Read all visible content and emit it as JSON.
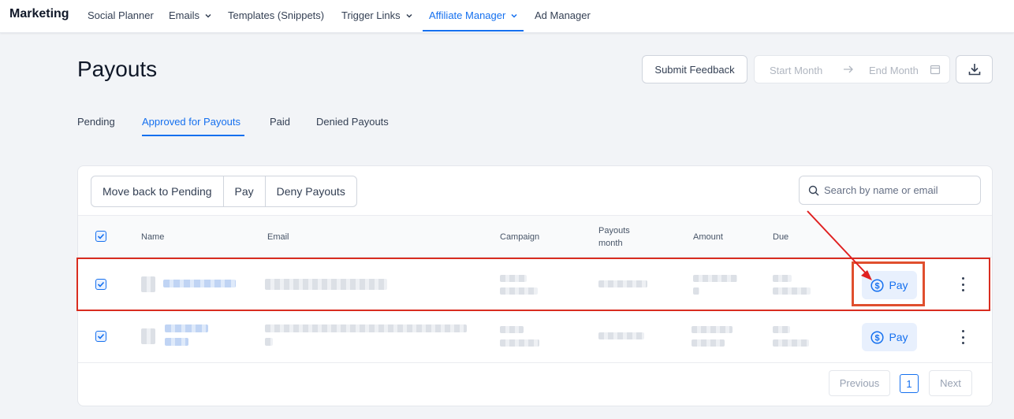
{
  "nav": {
    "brand": "Marketing",
    "items": [
      {
        "label": "Social Planner"
      },
      {
        "label": "Emails"
      },
      {
        "label": "Templates (Snippets)"
      },
      {
        "label": "Trigger Links"
      },
      {
        "label": "Affiliate Manager"
      },
      {
        "label": "Ad Manager"
      }
    ]
  },
  "header": {
    "title": "Payouts",
    "feedback_label": "Submit Feedback",
    "start_placeholder": "Start Month",
    "end_placeholder": "End Month",
    "download_icon": "download-icon"
  },
  "tabs": [
    {
      "label": "Pending"
    },
    {
      "label": "Approved for Payouts"
    },
    {
      "label": "Paid"
    },
    {
      "label": "Denied Payouts"
    }
  ],
  "actions": {
    "move_back": "Move back to Pending",
    "pay": "Pay",
    "deny": "Deny Payouts"
  },
  "search": {
    "placeholder": "Search by name or email"
  },
  "table": {
    "headers": {
      "name": "Name",
      "email": "Email",
      "campaign": "Campaign",
      "payouts_month_line1": "Payouts",
      "payouts_month_line2": "month",
      "amount": "Amount",
      "due": "Due"
    },
    "rows": [
      {
        "pay_label": "Pay",
        "selected": true
      },
      {
        "pay_label": "Pay",
        "selected": true
      }
    ]
  },
  "pagination": {
    "previous": "Previous",
    "page": "1",
    "next": "Next"
  },
  "colors": {
    "accent": "#1570ef",
    "annotation": "#d92d20"
  }
}
